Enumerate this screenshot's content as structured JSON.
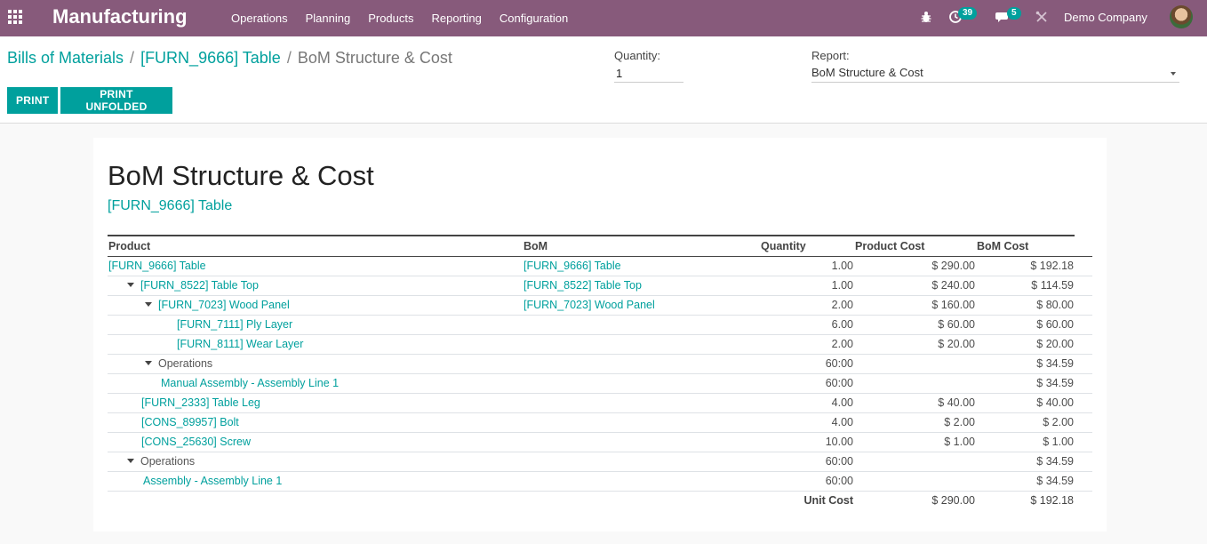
{
  "navbar": {
    "brand": "Manufacturing",
    "menu": [
      "Operations",
      "Planning",
      "Products",
      "Reporting",
      "Configuration"
    ],
    "activity_count": "39",
    "message_count": "5",
    "company": "Demo Company"
  },
  "breadcrumb": {
    "items": [
      "Bills of Materials",
      "[FURN_9666] Table"
    ],
    "current": "BoM Structure & Cost"
  },
  "controls": {
    "quantity_label": "Quantity:",
    "quantity_value": "1",
    "report_label": "Report:",
    "report_value": "BoM Structure & Cost",
    "print_label": "PRINT",
    "print_unfolded_label": "PRINT UNFOLDED"
  },
  "report": {
    "title": "BoM Structure & Cost",
    "subtitle": "[FURN_9666] Table",
    "columns": [
      "Product",
      "BoM",
      "Quantity",
      "Product Cost",
      "BoM Cost"
    ],
    "rows": [
      {
        "product": "[FURN_9666] Table",
        "bom": "[FURN_9666] Table",
        "qty": "1.00",
        "pcost": "$ 290.00",
        "bcost": "$ 192.18"
      },
      {
        "product": "[FURN_8522] Table Top",
        "bom": "[FURN_8522] Table Top",
        "qty": "1.00",
        "pcost": "$ 240.00",
        "bcost": "$ 114.59"
      },
      {
        "product": "[FURN_7023] Wood Panel",
        "bom": "[FURN_7023] Wood Panel",
        "qty": "2.00",
        "pcost": "$ 160.00",
        "bcost": "$ 80.00"
      },
      {
        "product": "[FURN_7111] Ply Layer",
        "bom": "",
        "qty": "6.00",
        "pcost": "$ 60.00",
        "bcost": "$ 60.00"
      },
      {
        "product": "[FURN_8111] Wear Layer",
        "bom": "",
        "qty": "2.00",
        "pcost": "$ 20.00",
        "bcost": "$ 20.00"
      },
      {
        "product": "Operations",
        "bom": "",
        "qty": "60:00",
        "pcost": "",
        "bcost": "$ 34.59"
      },
      {
        "product": "Manual Assembly - Assembly Line 1",
        "bom": "",
        "qty": "60:00",
        "pcost": "",
        "bcost": "$ 34.59"
      },
      {
        "product": "[FURN_2333] Table Leg",
        "bom": "",
        "qty": "4.00",
        "pcost": "$ 40.00",
        "bcost": "$ 40.00"
      },
      {
        "product": "[CONS_89957] Bolt",
        "bom": "",
        "qty": "4.00",
        "pcost": "$ 2.00",
        "bcost": "$ 2.00"
      },
      {
        "product": "[CONS_25630] Screw",
        "bom": "",
        "qty": "10.00",
        "pcost": "$ 1.00",
        "bcost": "$ 1.00"
      },
      {
        "product": "Operations",
        "bom": "",
        "qty": "60:00",
        "pcost": "",
        "bcost": "$ 34.59"
      },
      {
        "product": "Assembly - Assembly Line 1",
        "bom": "",
        "qty": "60:00",
        "pcost": "",
        "bcost": "$ 34.59"
      }
    ],
    "total": {
      "label": "Unit Cost",
      "pcost": "$ 290.00",
      "bcost": "$ 192.18"
    }
  }
}
